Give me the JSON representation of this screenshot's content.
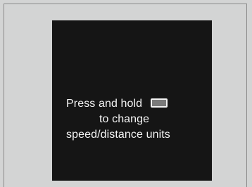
{
  "display": {
    "line1": "Press and hold",
    "line2": "to change",
    "line3": "speed/distance units",
    "button_icon": "steering-switch-button-icon"
  }
}
